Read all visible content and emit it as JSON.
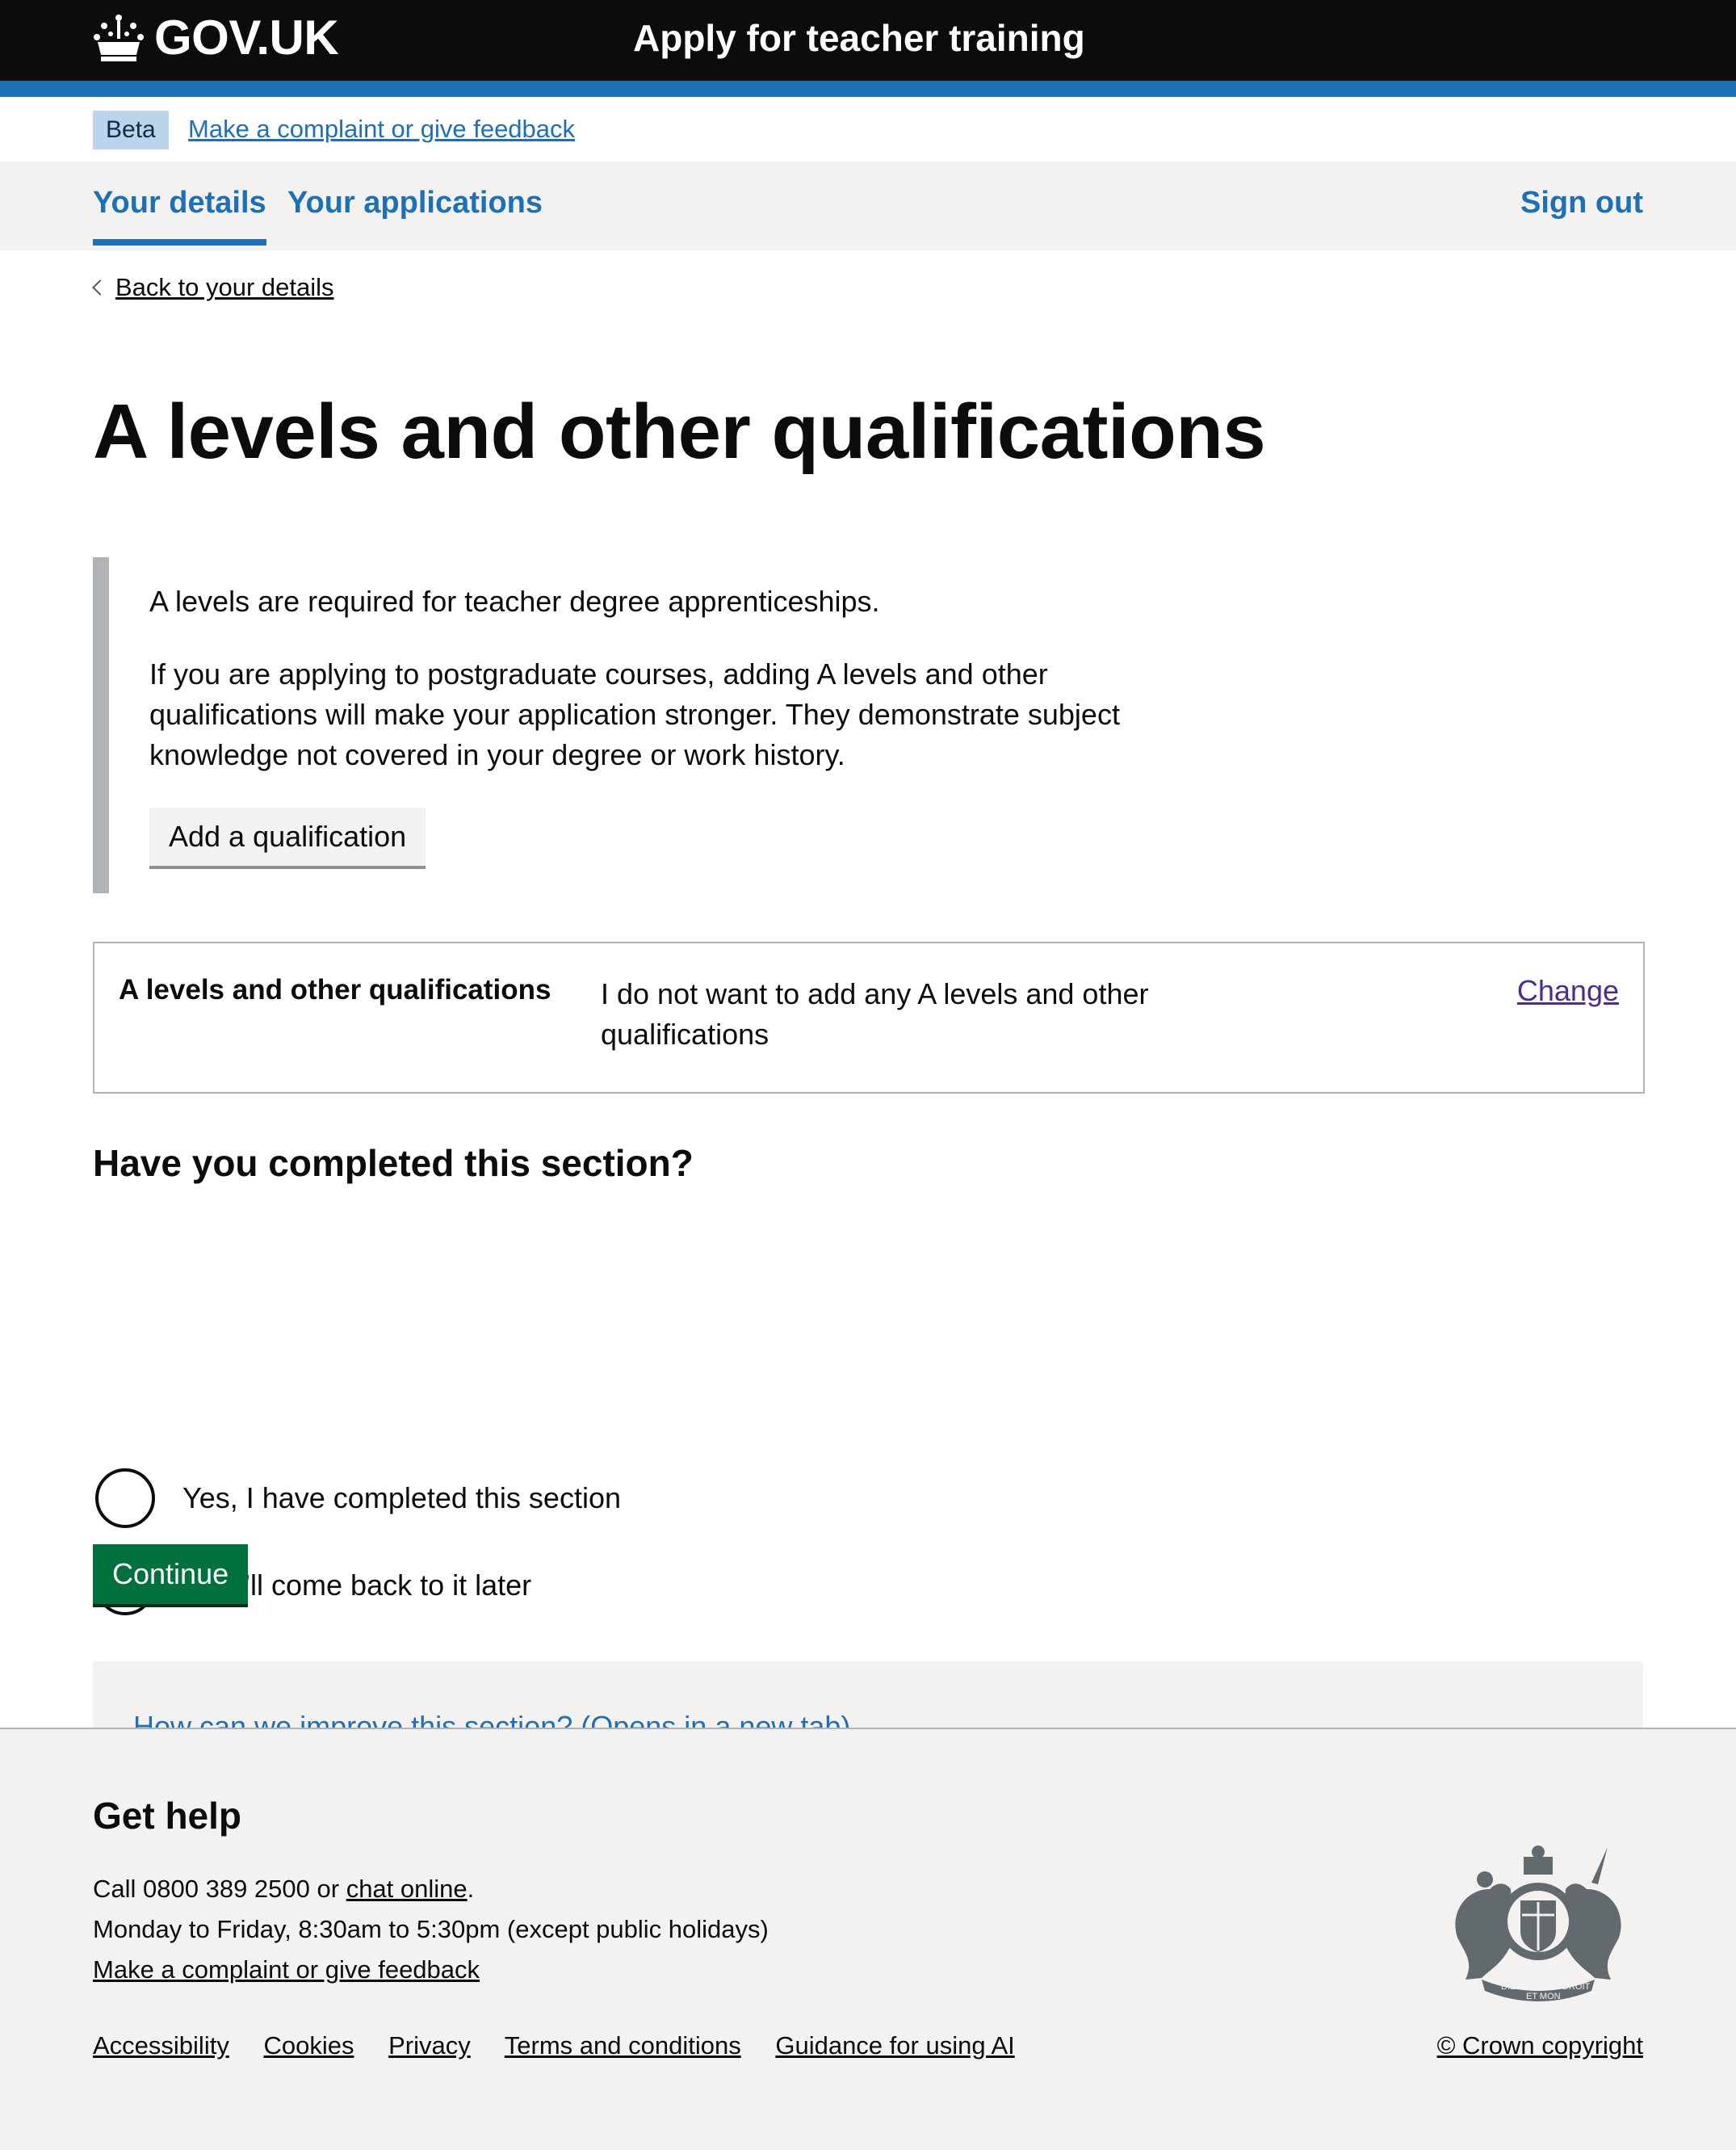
{
  "header": {
    "logo_text": "GOV.UK",
    "service_name": "Apply for teacher training"
  },
  "phase_banner": {
    "tag": "Beta",
    "link": "Make a complaint or give feedback"
  },
  "nav": {
    "your_details": "Your details",
    "your_applications": "Your applications",
    "sign_out": "Sign out"
  },
  "back_link": "Back to your details",
  "page_title": "A levels and other qualifications",
  "inset": {
    "para1": "A levels are required for teacher degree apprenticeships.",
    "para2": "If you are applying to postgraduate courses, adding A levels and other qualifications will make your application stronger. They demonstrate subject knowledge not covered in your degree or work history.",
    "add_button": "Add a qualification"
  },
  "summary": {
    "key": "A levels and other qualifications",
    "value": "I do not want to add any A levels and other qualifications",
    "change": "Change"
  },
  "completion": {
    "legend": "Have you completed this section?",
    "options": [
      "Yes, I have completed this section",
      "No, I’ll come back to it later"
    ],
    "selected": null
  },
  "continue_button": "Continue",
  "feedback_link": "How can we improve this section? (Opens in a new tab)",
  "footer": {
    "heading": "Get help",
    "call_prefix": "Call 0800 389 2500 or ",
    "chat_link": "chat online",
    "call_suffix": ".",
    "hours": "Monday to Friday, 8:30am to 5:30pm (except public holidays)",
    "complaint_link": "Make a complaint or give feedback",
    "links": [
      "Accessibility",
      "Cookies",
      "Privacy",
      "Terms and conditions",
      "Guidance for using AI"
    ],
    "copyright": "© Crown copyright",
    "crest_motto": [
      "DIEU",
      "ET MON",
      "DROIT"
    ]
  },
  "colors": {
    "header_bg": "#0b0c0c",
    "brand_blue": "#1d70b8",
    "button_green": "#00703c",
    "footer_bg": "#f3f2f1",
    "visited_link": "#4c2c92"
  }
}
